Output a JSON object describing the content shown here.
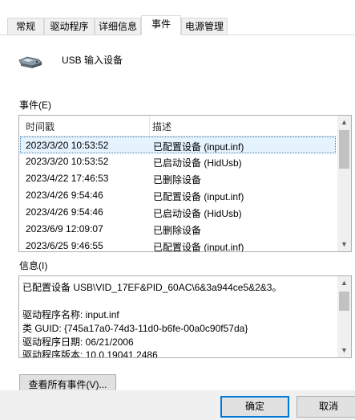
{
  "tabs": [
    {
      "label": "常规",
      "active": false
    },
    {
      "label": "驱动程序",
      "active": false
    },
    {
      "label": "详细信息",
      "active": false
    },
    {
      "label": "事件",
      "active": true
    },
    {
      "label": "电源管理",
      "active": false
    }
  ],
  "device": {
    "name": "USB 输入设备",
    "icon": "usb-device-icon"
  },
  "events": {
    "label": "事件(E)",
    "columns": [
      "时间戳",
      "描述"
    ],
    "rows": [
      {
        "timestamp": "2023/3/20 10:53:52",
        "description": "已配置设备 (input.inf)",
        "selected": true
      },
      {
        "timestamp": "2023/3/20 10:53:52",
        "description": "已启动设备 (HidUsb)",
        "selected": false
      },
      {
        "timestamp": "2023/4/22 17:46:53",
        "description": "已删除设备",
        "selected": false
      },
      {
        "timestamp": "2023/4/26 9:54:46",
        "description": "已配置设备 (input.inf)",
        "selected": false
      },
      {
        "timestamp": "2023/4/26 9:54:46",
        "description": "已启动设备 (HidUsb)",
        "selected": false
      },
      {
        "timestamp": "2023/6/9 12:09:07",
        "description": "已删除设备",
        "selected": false
      },
      {
        "timestamp": "2023/6/25 9:46:55",
        "description": "已配置设备 (input.inf)",
        "selected": false
      }
    ]
  },
  "info": {
    "label": "信息(I)",
    "lines": [
      "已配置设备 USB\\VID_17EF&PID_60AC\\6&3a944ce5&2&3。",
      "",
      "驱动程序名称: input.inf",
      "类 GUID: {745a17a0-74d3-11d0-b6fe-00a0c90f57da}",
      "驱动程序日期: 06/21/2006",
      "驱动程序版本: 10.0.19041.2486"
    ]
  },
  "buttons": {
    "view_all": "查看所有事件(V)...",
    "ok": "确定",
    "cancel": "取消"
  },
  "colors": {
    "selection_bg": "#e5f3ff",
    "default_button_border": "#0078d7",
    "button_bg": "#e1e1e1"
  }
}
